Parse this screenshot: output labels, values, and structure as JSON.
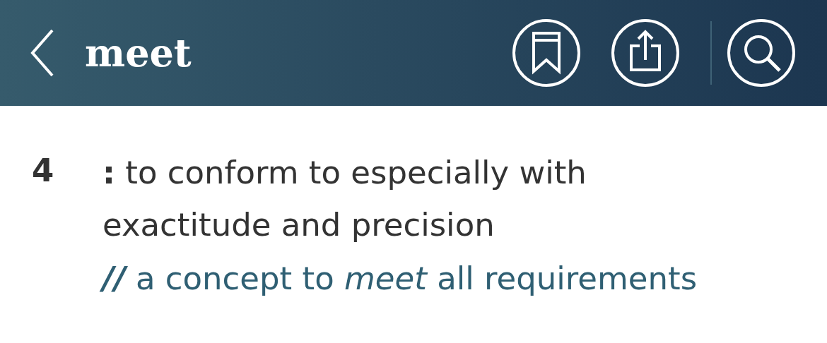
{
  "header": {
    "back": {
      "kind": "back"
    },
    "title": "meet",
    "actions": [
      {
        "kind": "bookmark"
      },
      {
        "kind": "share"
      },
      {
        "kind": "search"
      }
    ]
  },
  "entry": {
    "sense_number": "4",
    "definition": "**:** to conform to especially with exactitude and precision",
    "example": {
      "mark": "//",
      "text": "a concept to *meet* all requirements"
    }
  }
}
